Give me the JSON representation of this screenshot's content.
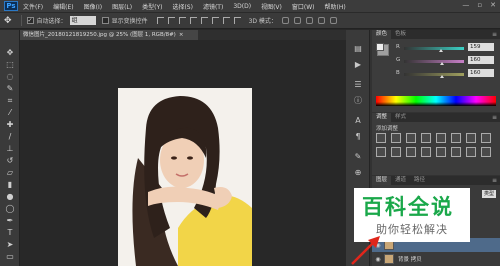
{
  "app": {
    "logo": "Ps"
  },
  "menubar": {
    "items": [
      "文件(F)",
      "编辑(E)",
      "图像(I)",
      "图层(L)",
      "类型(Y)",
      "选择(S)",
      "滤镜(T)",
      "3D(D)",
      "视图(V)",
      "窗口(W)",
      "帮助(H)"
    ],
    "window_buttons": [
      "—",
      "▫",
      "✕"
    ]
  },
  "options": {
    "auto_select_label": "自动选择：",
    "auto_select_value": "组",
    "show_transform_label": "显示变换控件",
    "mode_3d_label": "3D 模式："
  },
  "document": {
    "tab_title": "微信图片_20180121819250.jpg @ 25% (图层 1, RGB/8#)",
    "tab_close": "×"
  },
  "color_panel": {
    "tabs": [
      "颜色",
      "色板"
    ],
    "channels": [
      {
        "label": "R",
        "value": "159",
        "level": 0.62
      },
      {
        "label": "G",
        "value": "160",
        "level": 0.63
      },
      {
        "label": "B",
        "value": "160",
        "level": 0.63
      }
    ],
    "colors": {
      "r_track": "#3ad1c5",
      "g_track": "#c77fc7",
      "b_track": "#a0a05f",
      "foreground": "#eeeeee",
      "background": "#9f9f9f"
    }
  },
  "adjustments_panel": {
    "tabs": [
      "调整",
      "样式"
    ],
    "title": "添加调整"
  },
  "layers_panel": {
    "tabs": [
      "图层",
      "通道",
      "路径"
    ],
    "kind_label": "类型",
    "layers": [
      {
        "name": "",
        "selected": true
      },
      {
        "name": "背景 拷贝",
        "selected": false
      }
    ]
  },
  "watermark": {
    "title": "百科全说",
    "subtitle": "助你轻松解决",
    "title_color": "#1aa84a"
  },
  "icons": {
    "toolbox": [
      "move-icon",
      "marquee-icon",
      "lasso-icon",
      "quick-select-icon",
      "crop-icon",
      "eyedropper-icon",
      "healing-brush-icon",
      "brush-icon",
      "stamp-icon",
      "history-brush-icon",
      "eraser-icon",
      "gradient-icon",
      "blur-icon",
      "dodge-icon",
      "pen-icon",
      "type-icon"
    ]
  }
}
